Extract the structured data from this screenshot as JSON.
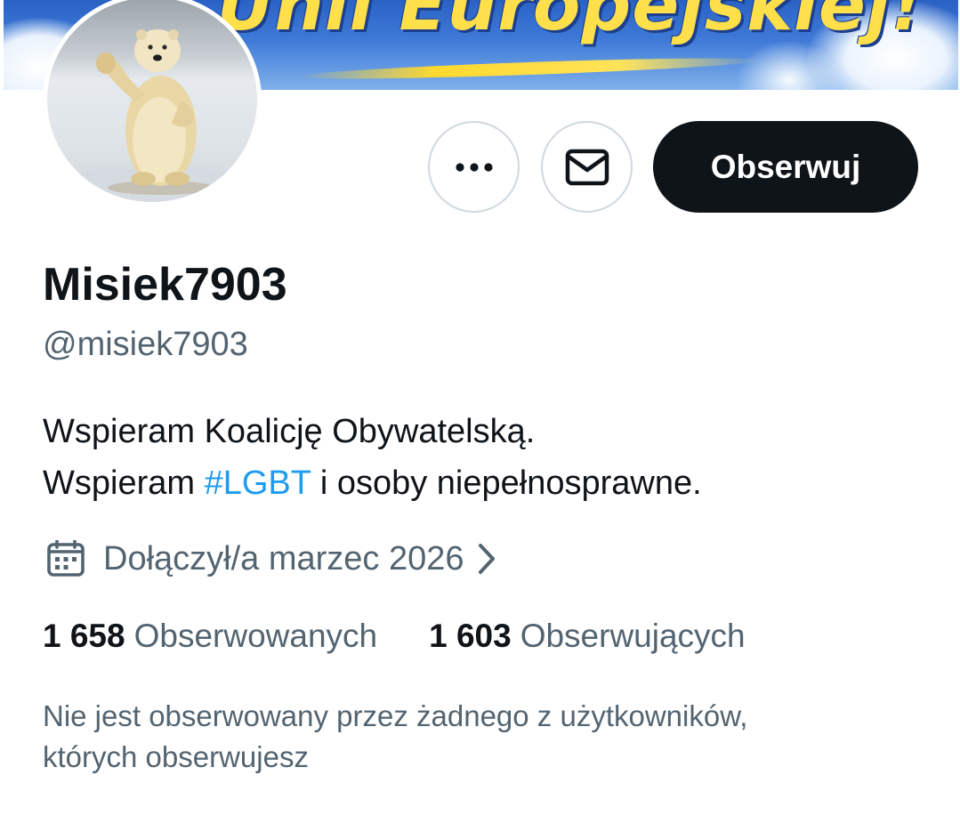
{
  "banner": {
    "text": "Unii Europejskiej!"
  },
  "actions": {
    "more_label": "More",
    "message_label": "Message",
    "follow_label": "Obserwuj"
  },
  "profile": {
    "display_name": "Misiek7903",
    "handle": "@misiek7903",
    "bio": {
      "line1": "Wspieram Koalicję Obywatelską.",
      "line2_prefix": "Wspieram ",
      "line2_hashtag": "#LGBT",
      "line2_suffix": " i osoby niepełnosprawne."
    },
    "joined": "Dołączył/a marzec 2026",
    "following": {
      "count": "1 658",
      "label": "Obserwowanych"
    },
    "followers": {
      "count": "1 603",
      "label": "Obserwujących"
    },
    "followed_by_note_line1": "Nie jest obserwowany przez żadnego z użytkowników,",
    "followed_by_note_line2": "których obserwujesz"
  },
  "icons": {
    "more": "more-horizontal-icon",
    "message": "envelope-icon",
    "calendar": "calendar-icon",
    "chevron": "chevron-right-icon"
  },
  "colors": {
    "text_primary": "#0f1419",
    "text_secondary": "#536471",
    "link": "#1d9bf0",
    "button_dark": "#0f1419",
    "border": "#cfd9de"
  }
}
